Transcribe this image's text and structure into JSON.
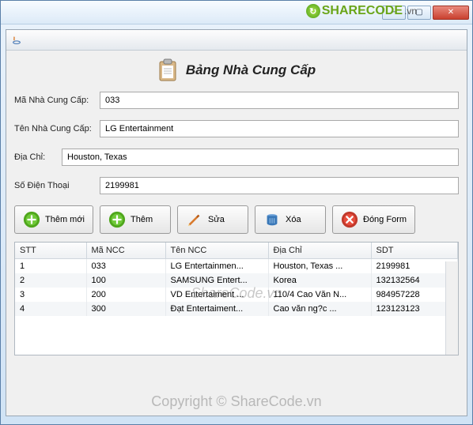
{
  "watermark": {
    "brand": "SHARECODE",
    "tld": ".vn",
    "center": "ShareCode.vn",
    "copyright": "Copyright © ShareCode.vn"
  },
  "header": {
    "title": "Bảng Nhà Cung Cấp"
  },
  "form": {
    "ma_ncc": {
      "label": "Mã Nhà Cung Cấp:",
      "value": "033"
    },
    "ten_ncc": {
      "label": "Tên Nhà Cung Cấp:",
      "value": "LG Entertainment"
    },
    "dia_chi": {
      "label": "Địa Chỉ:",
      "value": "Houston, Texas"
    },
    "sdt": {
      "label": "Số Điện Thoại",
      "value": "2199981"
    }
  },
  "buttons": {
    "them_moi": "Thêm mới",
    "them": "Thêm",
    "sua": "Sửa",
    "xoa": "Xóa",
    "dong": "Đóng Form"
  },
  "table": {
    "headers": {
      "stt": "STT",
      "ma": "Mã NCC",
      "ten": "Tên NCC",
      "diachi": "Địa Chỉ",
      "sdt": "SDT"
    },
    "rows": [
      {
        "stt": "1",
        "ma": "033",
        "ten": "LG Entertainmen...",
        "diachi": "Houston, Texas ...",
        "sdt": "2199981"
      },
      {
        "stt": "2",
        "ma": "100",
        "ten": "SAMSUNG Entert...",
        "diachi": "Korea",
        "sdt": "132132564"
      },
      {
        "stt": "3",
        "ma": "200",
        "ten": "VD Entertaiment ...",
        "diachi": "110/4 Cao Văn N...",
        "sdt": "984957228"
      },
      {
        "stt": "4",
        "ma": "300",
        "ten": "Đạt Entertaiment...",
        "diachi": "Cao văn ng?c  ...",
        "sdt": "123123123"
      }
    ]
  }
}
